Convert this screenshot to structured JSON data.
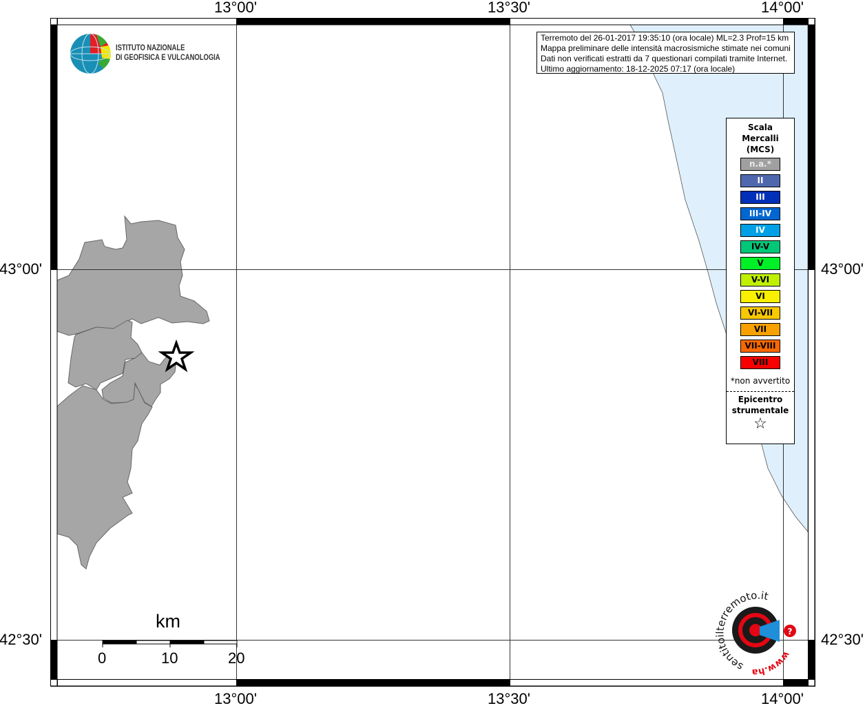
{
  "map": {
    "lon_labels": [
      "13°00'",
      "13°30'",
      "14°00'"
    ],
    "lat_labels": [
      "43°00'",
      "42°30'"
    ],
    "colors": {
      "land": "#a6a6a6",
      "sea": "#dff0fc",
      "frame": "#000000"
    }
  },
  "logo_ingv": {
    "line1": "ISTITUTO NAZIONALE",
    "line2": "DI GEOFISICA E VULCANOLOGIA"
  },
  "info": {
    "line1": "Terremoto del 26-01-2017 19:35:10 (ora locale) ML=2.3 Prof=15 km",
    "line2": "Mappa preliminare delle intensità macrosismiche stimate nei comuni",
    "line3": "Dati non verificati estratti da 7 questionari compilati tramite Internet.",
    "line4": "Ultimo aggiornamento: 18-12-2025 07:17 (ora locale)"
  },
  "legend": {
    "title1": "Scala",
    "title2": "Mercalli",
    "title3": "(MCS)",
    "items": [
      {
        "label": "n.a.*",
        "color": "#a0a0a0",
        "text": "#e8e8e8"
      },
      {
        "label": "II",
        "color": "#4f67ad",
        "text": "#ffffff"
      },
      {
        "label": "III",
        "color": "#0030b8",
        "text": "#ffffff"
      },
      {
        "label": "III-IV",
        "color": "#0066d0",
        "text": "#ffffff"
      },
      {
        "label": "IV",
        "color": "#00a0e6",
        "text": "#ffffff"
      },
      {
        "label": "IV-V",
        "color": "#00c878",
        "text": "#000000"
      },
      {
        "label": "V",
        "color": "#00f028",
        "text": "#000000"
      },
      {
        "label": "V-VI",
        "color": "#c0f000",
        "text": "#000000"
      },
      {
        "label": "VI",
        "color": "#f8f000",
        "text": "#000000"
      },
      {
        "label": "VI-VII",
        "color": "#f8c800",
        "text": "#000000"
      },
      {
        "label": "VII",
        "color": "#f8a000",
        "text": "#000000"
      },
      {
        "label": "VII-VIII",
        "color": "#f86800",
        "text": "#000000"
      },
      {
        "label": "VIII",
        "color": "#f80000",
        "text": "#000000"
      }
    ],
    "note": "*non avvertito",
    "epicenter1": "Epicentro",
    "epicenter2": "strumentale",
    "star": "☆"
  },
  "scalebar": {
    "unit": "km",
    "ticks": [
      "0",
      "10",
      "20"
    ]
  },
  "logo_hst": {
    "text": "www.haisentitoilterremoto.it"
  }
}
